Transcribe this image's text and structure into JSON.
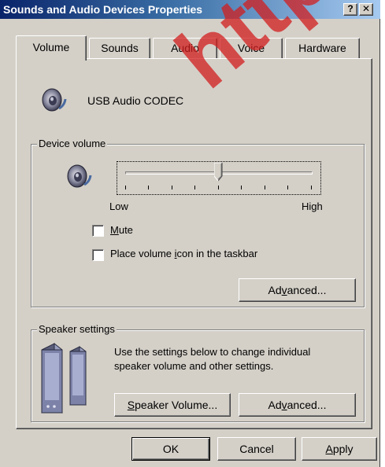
{
  "window": {
    "title": "Sounds and Audio Devices Properties",
    "help_glyph": "?",
    "close_glyph": "✕"
  },
  "tabs": [
    {
      "label": "Volume",
      "active": true
    },
    {
      "label": "Sounds",
      "active": false
    },
    {
      "label": "Audio",
      "active": false
    },
    {
      "label": "Voice",
      "active": false
    },
    {
      "label": "Hardware",
      "active": false
    }
  ],
  "device": {
    "name": "USB Audio CODEC",
    "icon": "speaker-icon"
  },
  "device_volume": {
    "group_label": "Device volume",
    "slider_low": "Low",
    "slider_high": "High",
    "slider_value": 0.5,
    "mute": {
      "pre": "",
      "key": "M",
      "post": "ute",
      "checked": false
    },
    "taskbar": {
      "pre": "Place volume ",
      "key": "i",
      "post": "con in the taskbar",
      "checked": false
    },
    "advanced": {
      "pre": "Ad",
      "key": "v",
      "post": "anced..."
    }
  },
  "speaker_settings": {
    "group_label": "Speaker settings",
    "description_line1": "Use the settings below to change individual",
    "description_line2": "speaker volume and other settings.",
    "speaker_volume": {
      "pre": "",
      "key": "S",
      "post": "peaker Volume..."
    },
    "advanced": {
      "pre": "Ad",
      "key": "v",
      "post": "anced..."
    }
  },
  "footer": {
    "ok": "OK",
    "cancel": "Cancel",
    "apply": {
      "pre": "",
      "key": "A",
      "post": "pply"
    }
  },
  "watermark": "http://x",
  "colors": {
    "titlebar_start": "#0a246a",
    "titlebar_end": "#a6caf0",
    "face": "#d4d0c8",
    "watermark": "#d21e1e"
  }
}
